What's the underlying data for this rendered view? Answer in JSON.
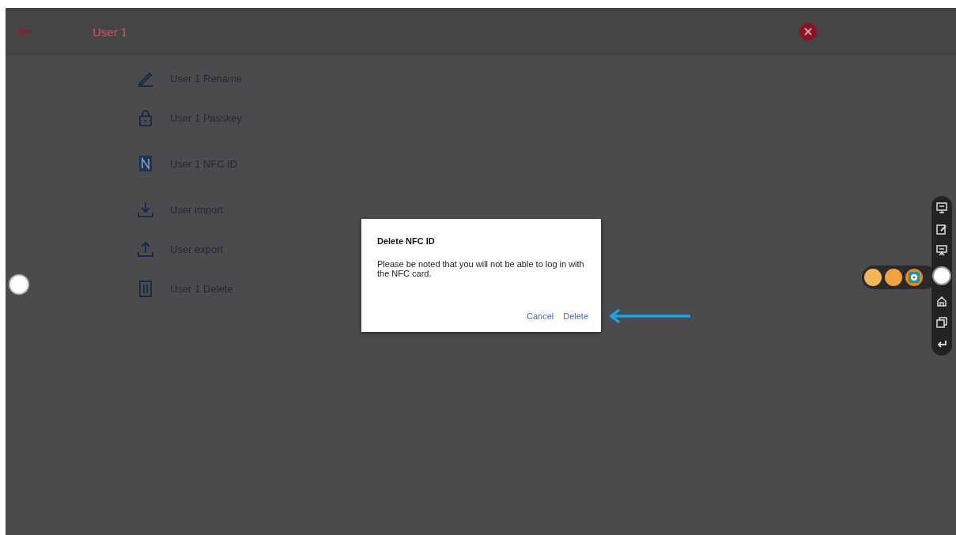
{
  "header": {
    "title": "User 1"
  },
  "menu": [
    {
      "label": "User 1 Rename",
      "kind": "rename"
    },
    {
      "label": "User 1 Passkey",
      "kind": "passkey"
    },
    {
      "label": "User 1 NFC ID",
      "kind": "nfc"
    },
    {
      "label": "User import",
      "kind": "import"
    },
    {
      "label": "User export",
      "kind": "export"
    },
    {
      "label": "User 1 Delete",
      "kind": "delete"
    }
  ],
  "dialog": {
    "title": "Delete NFC ID",
    "message": "Please be noted that you will not be able to log in with the NFC card.",
    "buttons": [
      "Cancel",
      "Delete"
    ]
  }
}
